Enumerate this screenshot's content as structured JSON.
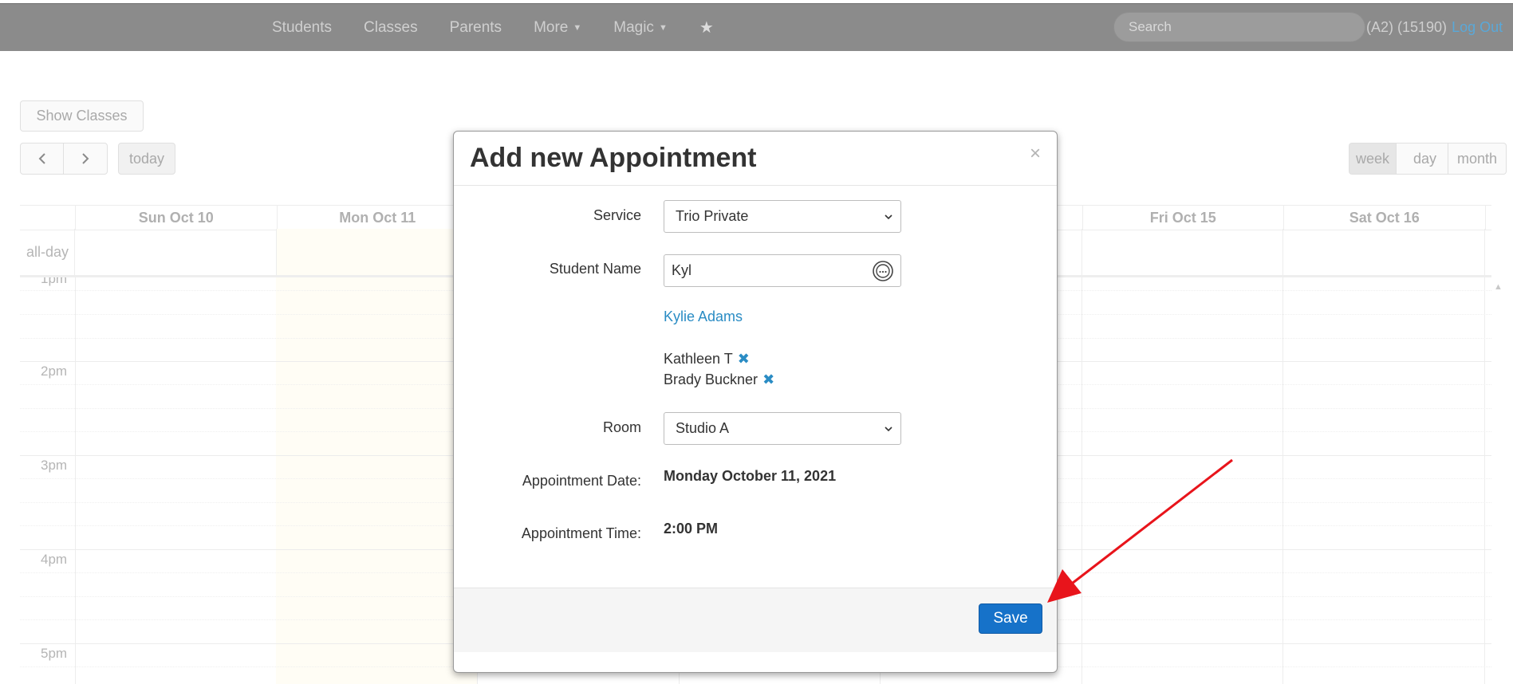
{
  "nav": {
    "items": [
      {
        "label": "Students",
        "dropdown": false
      },
      {
        "label": "Classes",
        "dropdown": false
      },
      {
        "label": "Parents",
        "dropdown": false
      },
      {
        "label": "More",
        "dropdown": true
      },
      {
        "label": "Magic",
        "dropdown": true
      }
    ],
    "star_icon": "star-icon",
    "search_placeholder": "Search",
    "user_info": "(A2) (15190)",
    "logout_label": "Log Out"
  },
  "calendar": {
    "show_classes_label": "Show Classes",
    "prev_icon": "chevron-left-icon",
    "next_icon": "chevron-right-icon",
    "today_label": "today",
    "views": [
      "week",
      "day",
      "month"
    ],
    "active_view": "week",
    "days": [
      "Sun Oct 10",
      "Mon Oct 11",
      "",
      "",
      "",
      "Fri Oct 15",
      "Sat Oct 16"
    ],
    "allday_label": "all-day",
    "hour_labels": [
      "1pm",
      "2pm",
      "3pm",
      "4pm",
      "5pm"
    ]
  },
  "modal": {
    "title": "Add new Appointment",
    "close_symbol": "×",
    "service": {
      "label": "Service",
      "value": "Trio Private"
    },
    "student": {
      "label": "Student Name",
      "value": "Kyl",
      "suggestion": "Kylie Adams"
    },
    "selected_students": [
      "Kathleen T",
      "Brady Buckner"
    ],
    "remove_symbol": "✖",
    "room": {
      "label": "Room",
      "value": "Studio A"
    },
    "date": {
      "label": "Appointment Date:",
      "value": "Monday October 11, 2021"
    },
    "time": {
      "label": "Appointment Time:",
      "value": "2:00 PM"
    },
    "save_label": "Save"
  },
  "colors": {
    "primary": "#1672c9",
    "link": "#2a8cc4",
    "annotation_arrow": "#e8141b",
    "navbar": "#8b8b8b"
  }
}
